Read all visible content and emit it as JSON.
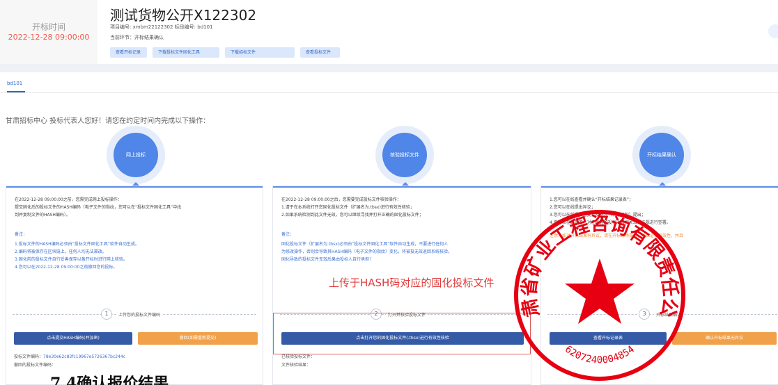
{
  "header": {
    "open_time_label": "开标时间",
    "open_time_value": "2022-12-28 09:00:00",
    "title": "测试货物公开X122302",
    "meta_line1": "项目编号: xmbm22122302   标段编号: bd101",
    "meta_line2": "当前环节：开标结果确认",
    "buttons": [
      "查看开标记录",
      "下载投标文件固化工具",
      "下载招标文件",
      "查看投标文件"
    ]
  },
  "tabs": [
    {
      "label": "bd101",
      "active": true
    }
  ],
  "greeting": "甘肃招标中心 投标代表人您好！请您在约定时间内完成以下操作：",
  "steps": [
    {
      "circle_label": "网上投标",
      "text": [
        "在2022-12-28 09:00:00之前，您需完成网上投标操作：",
        "提交固化后的投标文件的HASH编码（电子文件的指纹，您可以在“投标文件固化工具”中找",
        "到并复制文件的HASH编码）。"
      ],
      "note_title": "备注：",
      "notes": [
        "1.投标文件的HASH编码必须由“投标文件固化工具”软件自动生成。",
        "2.编码将被保存在区块链上，任何人均无法篡改。",
        "3.固化前的投标文件自行妥善保存以备开标时进行网上核验。",
        "4.您可以在2022-12-28 09:00:00之前撤回您的投标。"
      ],
      "step_number": "1",
      "step_label": "上传您的投标文件编码",
      "button_primary": "点击提交HASH编码(并加密)",
      "button_secondary": "撤回(如需重新提交)",
      "footer_label": "投标文件编码：",
      "footer_hash": "78e30e62c83fc19967e5726367bc244c",
      "footer_label2": "撤回的投标文件编码："
    },
    {
      "circle_label": "核验投标文件",
      "text": [
        "在2022-12-28 09:00:00之后，您需要完成投标文件核验操作：",
        "1.请于在本系统打开您固化投标文件（扩展名为.tbsx)进行有效性核验；",
        "2.如果系统检测到此文件无效，您可以继续寻找并打开正确的固化投标文件；"
      ],
      "note_title": "备注：",
      "notes": [
        "固化投标文件（扩展名为.tbsx)必须由“投标文件固化工具”软件自动生成，不要进行任何人",
        "为修改操作，否则会导致其HASH编码（电子文件的指纹）变化，将被投无效退回系统核验。",
        "固化导致的投标文件无效后果由投标人自行承担！"
      ],
      "annotation": "上传于HASH码对应的固化投标文件",
      "step_number": "2",
      "step_label": "打开并核验投标文件",
      "button_primary": "点击打开您的固化投标文件(.tbsx)进行有效性核验",
      "footer_label": "已核验投标文件：",
      "footer_label2": "文件核验结果："
    },
    {
      "circle_label": "开标结果确认",
      "text": [
        "1.您可以在线查看并确认“开标结果记录表”；",
        "2.您可以在线提出异议；",
        "3.您可以在线提交答复，招标人（代理机构）提出；",
        "4.您可以在线签署，对于所有的投标人和相关法律法规进行签署。"
      ],
      "warning": "注意：如对开标结果有异议，请在开标现场提出，以保证其有效性，并且",
      "step_number": "3",
      "step_label": "开标结果确认",
      "button_primary": "查看开标记录表",
      "button_secondary": "确认开标结果无异议"
    }
  ],
  "seal": {
    "outer_text": "甘肃省矿业工程咨询有限责任公司",
    "number": "6207240004854"
  },
  "footer_title": "7.4确认报价结果",
  "colors": {
    "accent": "#4f86e8",
    "button_blue": "#355aa6",
    "button_orange": "#f0a14a",
    "time_red": "#f05a4a",
    "seal_red": "#e60012"
  }
}
